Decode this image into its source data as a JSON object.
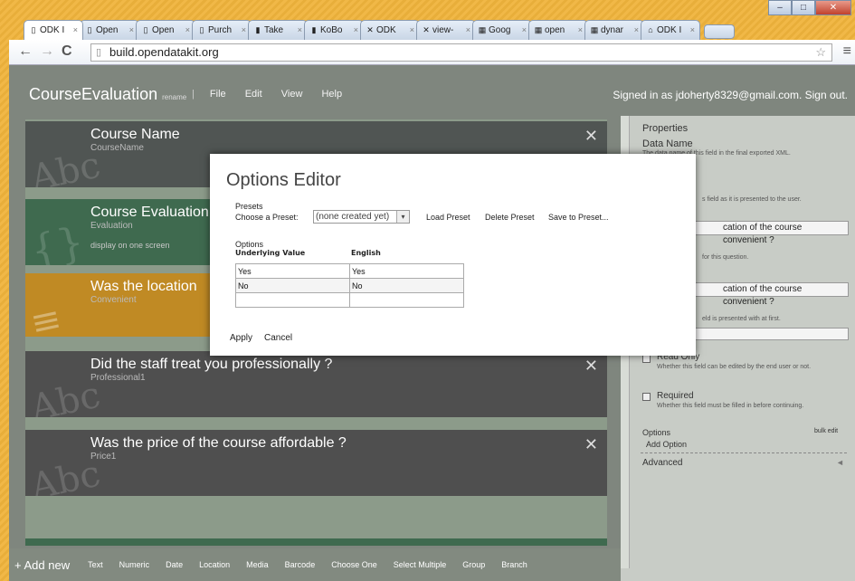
{
  "browser": {
    "tabs": [
      {
        "label": "ODK I",
        "icon": "page-icon",
        "active": true
      },
      {
        "label": "Open",
        "icon": "page-icon"
      },
      {
        "label": "Open",
        "icon": "page-icon"
      },
      {
        "label": "Purch",
        "icon": "page-icon"
      },
      {
        "label": "Take",
        "icon": "doc-icon"
      },
      {
        "label": "KoBo",
        "icon": "doc-icon"
      },
      {
        "label": "ODK",
        "icon": "odk-icon"
      },
      {
        "label": "view-",
        "icon": "odk-icon"
      },
      {
        "label": "Goog",
        "icon": "google-icon"
      },
      {
        "label": "open",
        "icon": "google-icon"
      },
      {
        "label": "dynar",
        "icon": "google-icon"
      },
      {
        "label": "ODK I",
        "icon": "home-icon"
      }
    ],
    "url": "build.opendatakit.org"
  },
  "app": {
    "title": "CourseEvaluation",
    "rename": "rename",
    "menus": [
      "File",
      "Edit",
      "View",
      "Help"
    ],
    "signed_in": "Signed in as jdoherty8329@gmail.com. Sign out."
  },
  "cards": [
    {
      "title": "Course Name",
      "sub": "CourseName",
      "extra": "",
      "icon": "abc-icon"
    },
    {
      "title": "Course Evaluation",
      "sub": "Evaluation",
      "extra": "display on one screen",
      "icon": "braces-icon"
    },
    {
      "title": "Was the location",
      "sub": "Convenient",
      "extra": "",
      "icon": "choice-icon"
    },
    {
      "title": "Did the staff treat you professionally ?",
      "sub": "Professional1",
      "extra": "",
      "icon": "abc-icon"
    },
    {
      "title": "Was the price of the course affordable ?",
      "sub": "Price1",
      "extra": "",
      "icon": "abc-icon"
    }
  ],
  "addbar": {
    "add_new": "+ Add new",
    "items": [
      "Text",
      "Numeric",
      "Date",
      "Location",
      "Media",
      "Barcode",
      "Choose One",
      "Select Multiple",
      "Group",
      "Branch"
    ]
  },
  "properties": {
    "title": "Properties",
    "data_name": "Data Name",
    "data_name_desc": "The data name of this field in the final exported XML.",
    "label_desc": "s field as it is presented to the user.",
    "label_value": "cation of the course convenient ?",
    "hint_desc": "for this question.",
    "default_value": "cation of the course convenient ?",
    "default_desc": "eld is presented with at first.",
    "read_only": "Read Only",
    "read_only_desc": "Whether this field can be edited by the end user or not.",
    "required": "Required",
    "required_desc": "Whether this field must be filled in before continuing.",
    "options": "Options",
    "bulk_edit": "bulk edit",
    "add_option": "Add Option",
    "advanced": "Advanced"
  },
  "modal": {
    "title": "Options Editor",
    "presets_label": "Presets",
    "choose_label": "Choose a Preset:",
    "preset_value": "(none created yet)",
    "load": "Load Preset",
    "delete": "Delete Preset",
    "save": "Save to Preset...",
    "options_label": "Options",
    "col_value": "Underlying Value",
    "col_english": "English",
    "rows": [
      [
        "Yes",
        "Yes"
      ],
      [
        "No",
        "No"
      ],
      [
        "",
        ""
      ]
    ],
    "apply": "Apply",
    "cancel": "Cancel"
  }
}
